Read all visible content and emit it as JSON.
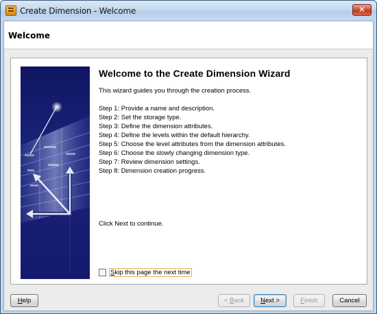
{
  "window": {
    "title": "Create Dimension - Welcome",
    "close_label": "✕"
  },
  "header": {
    "title": "Welcome"
  },
  "main": {
    "wizard_title": "Welcome to the Create Dimension Wizard",
    "description": "This wizard guides you through the creation process.",
    "steps": [
      "Step 1: Provide a name and description.",
      "Step 2: Set the storage type.",
      "Step 3: Define the dimension attributes.",
      "Step 4: Define the levels within the default hierarchy.",
      "Step 5: Choose the level attributes from the dimension attributes.",
      "Step 6: Choose the slowly changing dimension type.",
      "Step 7: Review dimension settings.",
      "Step 8: Dimension creation progress."
    ],
    "continue_text": "Click Next to continue.",
    "skip_checkbox": {
      "label_prefix": "",
      "label_mnemonic": "S",
      "label_rest": "kip this page the next time",
      "checked": false
    }
  },
  "buttons": {
    "help": {
      "mnemonic": "H",
      "rest": "elp"
    },
    "back": {
      "prefix": "< ",
      "mnemonic": "B",
      "rest": "ack"
    },
    "next": {
      "mnemonic": "N",
      "rest": "ext >"
    },
    "finish": {
      "mnemonic": "F",
      "rest": "inish"
    },
    "cancel": {
      "label": "Cancel"
    }
  },
  "colors": {
    "banner": "#141a6c",
    "accent_focus": "#e8b04a",
    "titlebar": "#c4d8ee",
    "close": "#c23a1c"
  }
}
